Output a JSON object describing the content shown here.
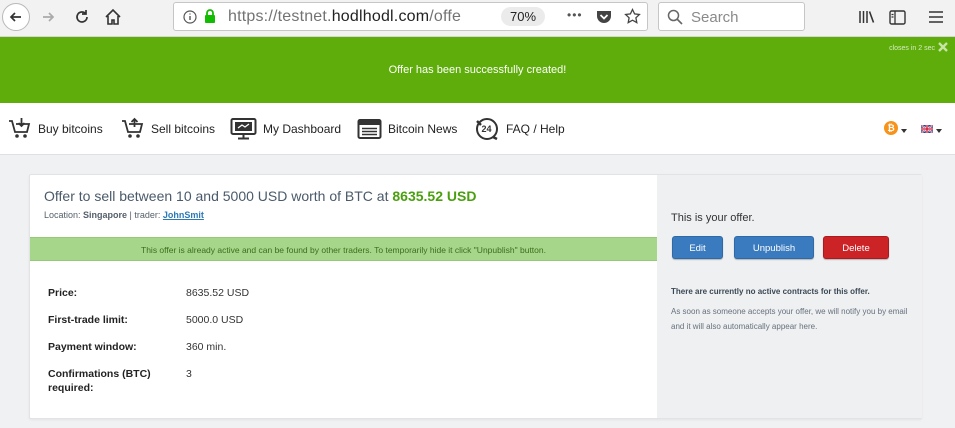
{
  "browser": {
    "url_prefix": "https://testnet.",
    "url_domain": "hodlhodl.com",
    "url_suffix": "/offe",
    "zoom": "70%",
    "search_placeholder": "Search",
    "more_icon": "•••"
  },
  "notification": {
    "message": "Offer has been successfully created!",
    "closes_text": "closes in 2 sec"
  },
  "site_nav": {
    "items": [
      {
        "label": "Buy bitcoins",
        "icon": "cart-download-icon"
      },
      {
        "label": "Sell bitcoins",
        "icon": "cart-upload-icon"
      },
      {
        "label": "My Dashboard",
        "icon": "monitor-icon"
      },
      {
        "label": "Bitcoin News",
        "icon": "newspaper-icon"
      },
      {
        "label": "FAQ / Help",
        "icon": "support-24-icon"
      }
    ],
    "currency_symbol": "₿"
  },
  "offer": {
    "title_prefix": "Offer to sell between 10 and 5000 USD worth of BTC at ",
    "title_price": "8635.52 USD",
    "location_label": "Location: ",
    "location": "Singapore",
    "trader_label": " | trader: ",
    "trader": "JohnSmit",
    "active_notice": "This offer is already active and can be found by other traders. To temporarily hide it click \"Unpublish\" button.",
    "details": [
      {
        "label": "Price:",
        "value": "8635.52  USD"
      },
      {
        "label": "First-trade limit:",
        "value": "5000.0 USD"
      },
      {
        "label": "Payment window:",
        "value": "360 min."
      },
      {
        "label": "Confirmations (BTC)",
        "label2": "required:",
        "value": "3"
      }
    ]
  },
  "sidebar": {
    "your_offer": "This is your offer.",
    "edit_label": "Edit",
    "unpublish_label": "Unpublish",
    "delete_label": "Delete",
    "no_contracts": "There are currently no active contracts for this offer.",
    "notify_text": "As soon as someone accepts your offer, we will notify you by email and it will also automatically appear here."
  },
  "colors": {
    "notification_green": "#5fad0b",
    "price_green": "#4a9f0e",
    "active_bar": "#a6d68a",
    "button_blue": "#3a7bbf",
    "button_red": "#cc2327",
    "bitcoin_orange": "#f7931a"
  }
}
